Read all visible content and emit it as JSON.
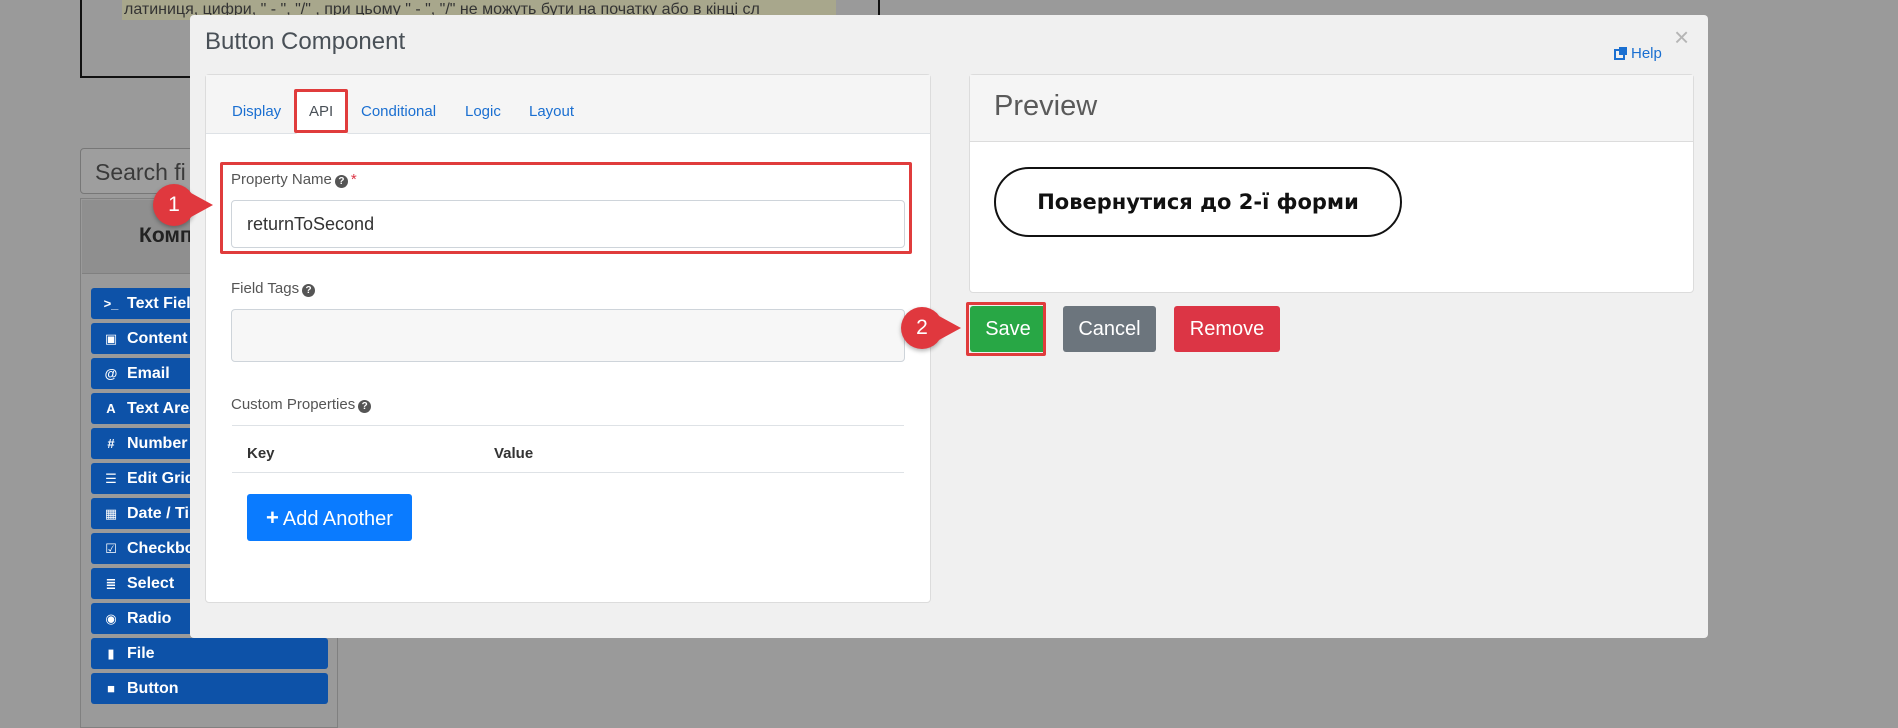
{
  "background": {
    "hint_text": "латиниця, цифри, \" - \", \"/\" , при цьому \" - \", \"/\" не можуть бути на початку або в кінці сл",
    "search_placeholder": "Search fi",
    "panel_title": "Комп",
    "components": [
      {
        "label": "Text Field",
        "icon": "terminal-icon",
        "glyph": ">_"
      },
      {
        "label": "Content",
        "icon": "html5-icon",
        "glyph": "▣"
      },
      {
        "label": "Email",
        "icon": "at-icon",
        "glyph": "@"
      },
      {
        "label": "Text Area",
        "icon": "font-icon",
        "glyph": "A"
      },
      {
        "label": "Number",
        "icon": "hashtag-icon",
        "glyph": "#"
      },
      {
        "label": "Edit Grid",
        "icon": "tasks-icon",
        "glyph": "☰"
      },
      {
        "label": "Date / Time",
        "icon": "calendar-icon",
        "glyph": "▦"
      },
      {
        "label": "Checkbox",
        "icon": "check-square-icon",
        "glyph": "☑"
      },
      {
        "label": "Select",
        "icon": "list-icon",
        "glyph": "≣"
      },
      {
        "label": "Radio",
        "icon": "dot-circle-icon",
        "glyph": "◉"
      },
      {
        "label": "File",
        "icon": "file-icon",
        "glyph": "▮"
      },
      {
        "label": "Button",
        "icon": "stop-icon",
        "glyph": "■"
      }
    ]
  },
  "modal": {
    "title": "Button Component",
    "help_label": "Help",
    "close_symbol": "×",
    "tabs": [
      "Display",
      "API",
      "Conditional",
      "Logic",
      "Layout"
    ],
    "active_tab": "API",
    "property_name": {
      "label": "Property Name",
      "required_marker": "*",
      "value": "returnToSecond"
    },
    "field_tags": {
      "label": "Field Tags",
      "value": ""
    },
    "custom_properties": {
      "label": "Custom Properties",
      "columns": [
        "Key",
        "Value"
      ],
      "add_label": "Add Another"
    },
    "preview": {
      "title": "Preview",
      "button_label": "Повернутися до 2-ї форми"
    },
    "actions": {
      "save": "Save",
      "cancel": "Cancel",
      "remove": "Remove"
    }
  },
  "callouts": [
    "1",
    "2"
  ],
  "colors": {
    "primary": "#0a7bff",
    "save": "#28a745",
    "cancel": "#6c757d",
    "remove": "#dc3545",
    "highlight": "#e03c3c"
  }
}
